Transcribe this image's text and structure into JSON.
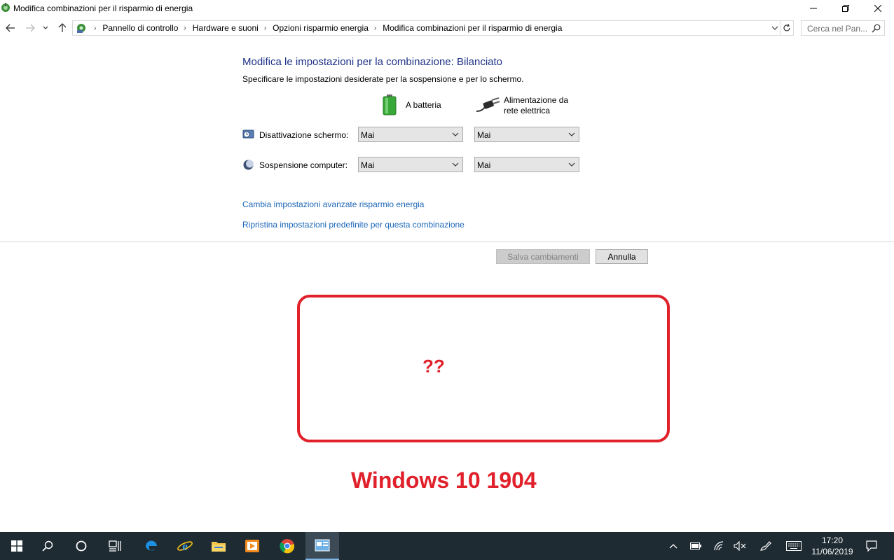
{
  "window": {
    "title": "Modifica combinazioni per il risparmio di energia"
  },
  "address_bar": {
    "crumbs": [
      "Pannello di controllo",
      "Hardware e suoni",
      "Opzioni risparmio energia",
      "Modifica combinazioni per il risparmio di energia"
    ],
    "search_placeholder": "Cerca nel Pan..."
  },
  "content": {
    "heading": "Modifica le impostazioni per la combinazione: Bilanciato",
    "subheading": "Specificare le impostazioni desiderate per la sospensione e per lo schermo.",
    "col_battery": "A batteria",
    "col_ac_line1": "Alimentazione da",
    "col_ac_line2": "rete elettrica",
    "rows": [
      {
        "label": "Disattivazione schermo:",
        "battery": "Mai",
        "ac": "Mai"
      },
      {
        "label": "Sospensione computer:",
        "battery": "Mai",
        "ac": "Mai"
      }
    ],
    "link_advanced": "Cambia impostazioni avanzate risparmio energia",
    "link_restore": "Ripristina impostazioni predefinite per questa combinazione",
    "save_label": "Salva cambiamenti",
    "cancel_label": "Annulla"
  },
  "annotation": {
    "question": "??",
    "version": "Windows 10 1904",
    "color": "#e0202a"
  },
  "taskbar": {
    "time": "17:20",
    "date": "11/06/2019"
  }
}
